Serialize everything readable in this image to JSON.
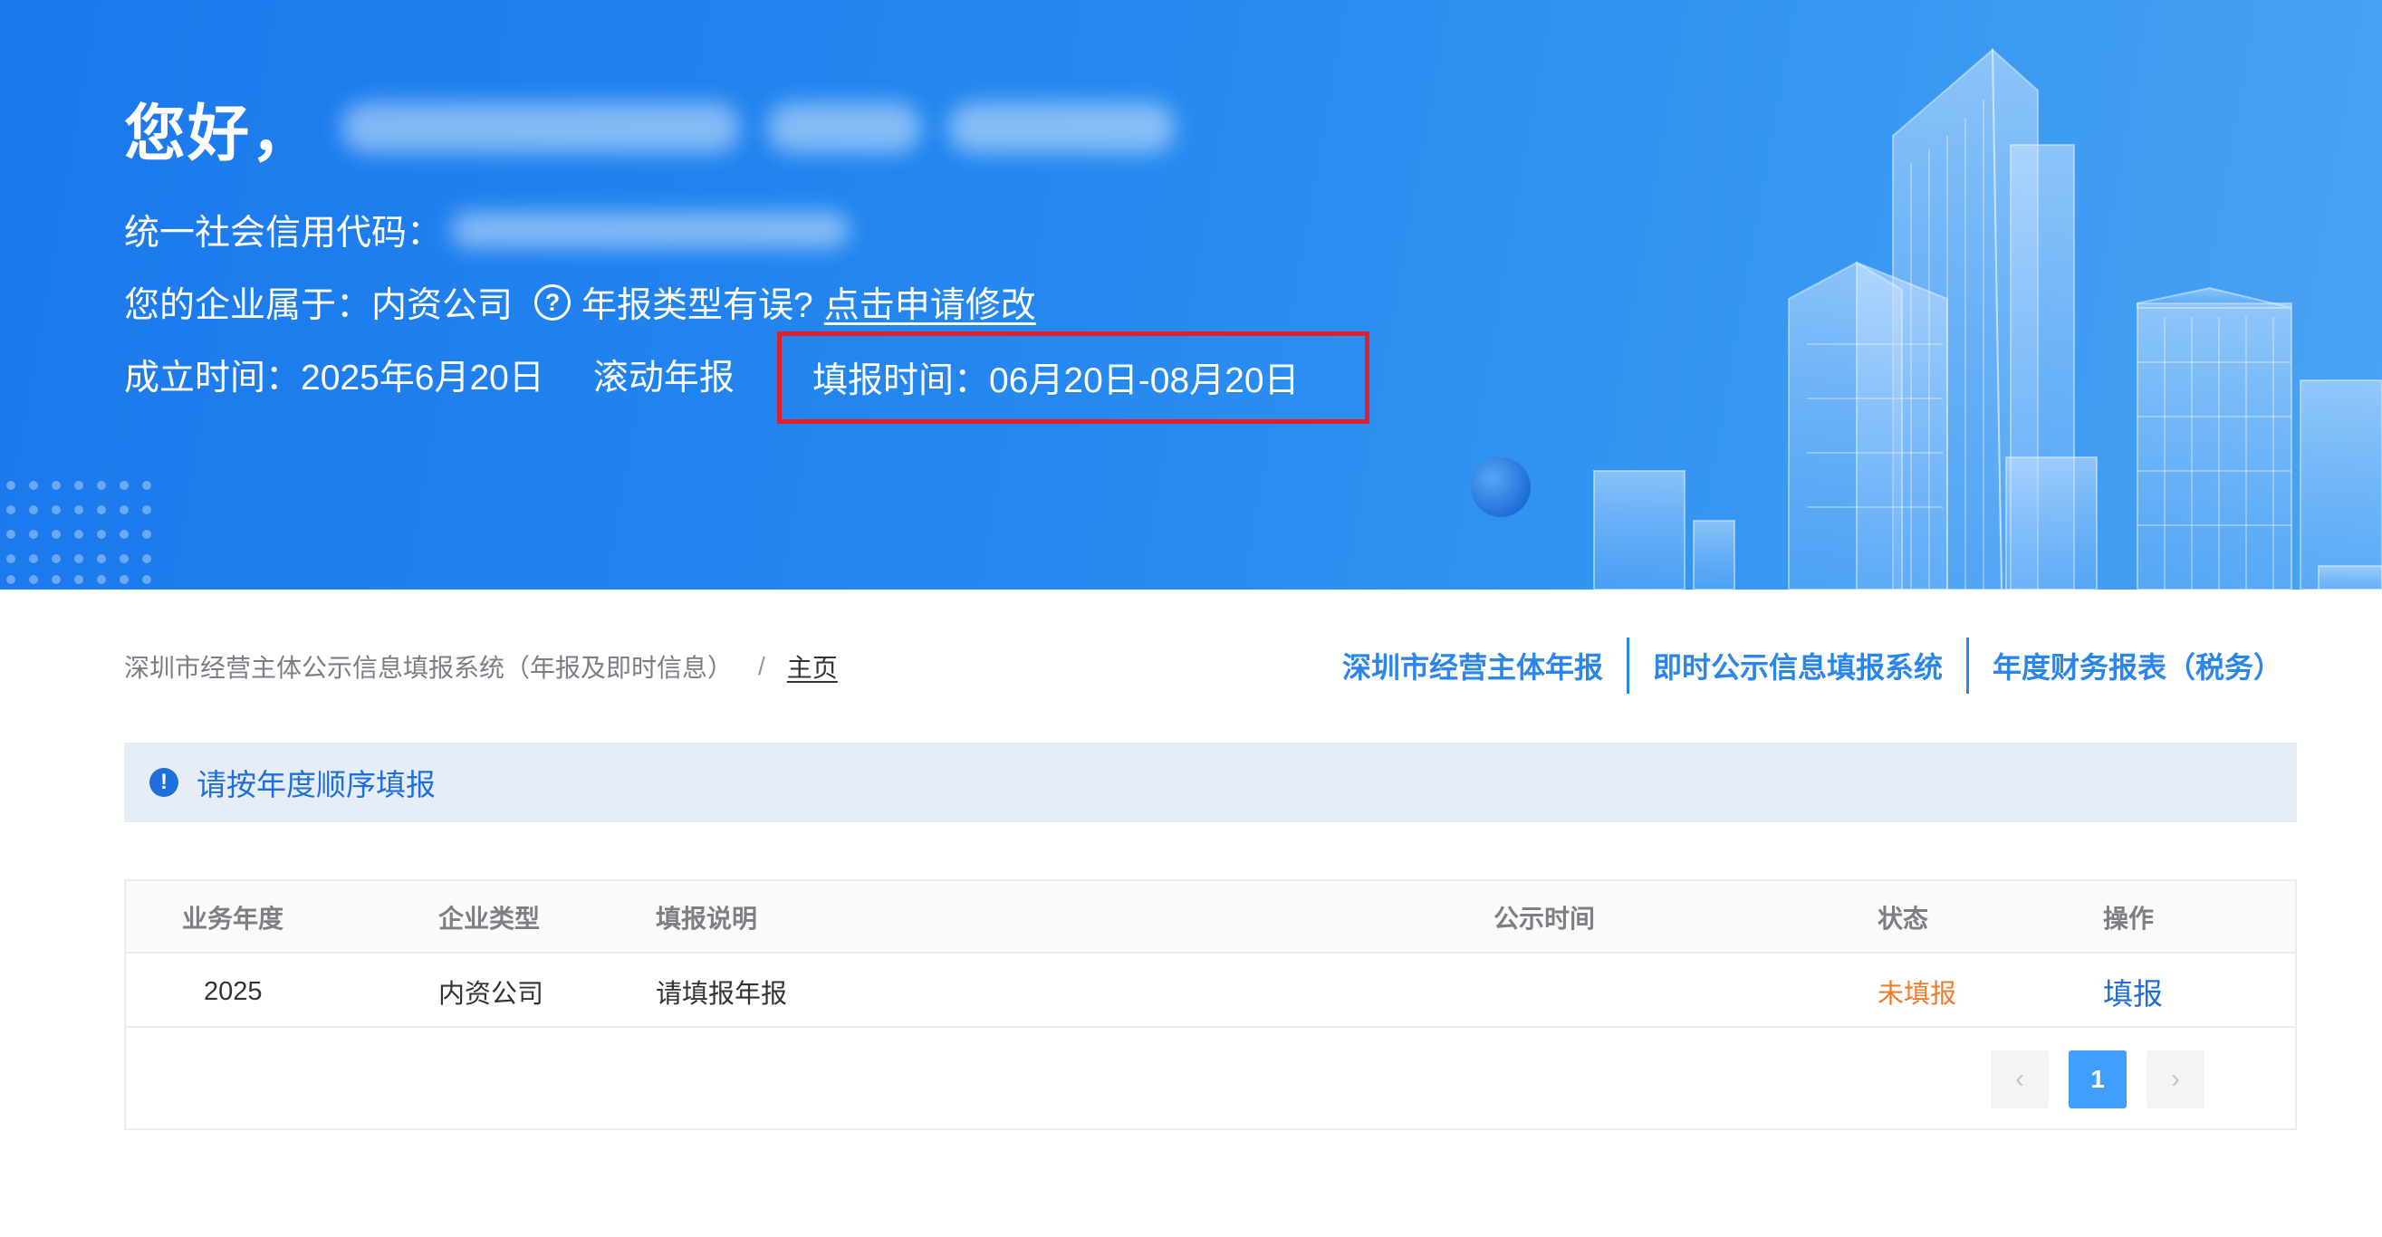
{
  "hero": {
    "greeting": "您好，",
    "credit_code_label": "统一社会信用代码：",
    "enterprise_type_label": "您的企业属于：",
    "enterprise_type_value": "内资公司",
    "type_error_text": "年报类型有误?",
    "apply_modify_link": "点击申请修改",
    "established_label": "成立时间：",
    "established_value": "2025年6月20日",
    "rolling_report": "滚动年报",
    "fill_time_label": "填报时间：",
    "fill_time_value": "06月20日-08月20日",
    "help_icon_glyph": "?"
  },
  "breadcrumb": {
    "system_name": "深圳市经营主体公示信息填报系统（年报及即时信息）",
    "separator": "/",
    "current": "主页"
  },
  "top_links": [
    "深圳市经营主体年报",
    "即时公示信息填报系统",
    "年度财务报表（税务）"
  ],
  "notice": {
    "icon": "!",
    "text": "请按年度顺序填报"
  },
  "table": {
    "columns": [
      "业务年度",
      "企业类型",
      "填报说明",
      "公示时间",
      "状态",
      "操作"
    ],
    "rows": [
      {
        "year": "2025",
        "type": "内资公司",
        "desc": "请填报年报",
        "publish_time": "",
        "status": "未填报",
        "action": "填报"
      }
    ]
  },
  "pagination": {
    "prev": "‹",
    "current_page": "1",
    "next": "›"
  },
  "colors": {
    "brand_blue": "#1b78ec",
    "link_blue": "#2b86e8",
    "highlight_red": "#e01f2d",
    "status_orange": "#f07b2c",
    "pager_active": "#409eff"
  }
}
